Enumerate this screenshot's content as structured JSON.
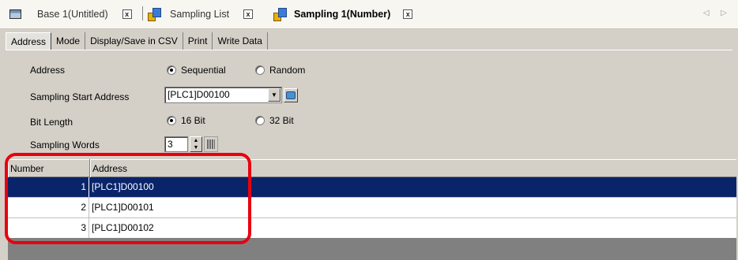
{
  "doc_tabs": [
    {
      "label": "Base 1(Untitled)",
      "icon": "screen-icon"
    },
    {
      "label": "Sampling List",
      "icon": "sampling-icon"
    },
    {
      "label": "Sampling 1(Number)",
      "icon": "sampling-icon",
      "active": true
    }
  ],
  "close_glyph": "x",
  "scroll_glyphs": "◁ ▷",
  "sub_tabs": [
    {
      "label": "Address",
      "active": true
    },
    {
      "label": "Mode"
    },
    {
      "label": "Display/Save in CSV"
    },
    {
      "label": "Print"
    },
    {
      "label": "Write Data"
    }
  ],
  "form": {
    "address_label": "Address",
    "address_options": [
      {
        "label": "Sequential",
        "selected": true
      },
      {
        "label": "Random",
        "selected": false
      }
    ],
    "start_address_label": "Sampling Start Address",
    "start_address_value": "[PLC1]D00100",
    "bit_length_label": "Bit Length",
    "bit_length_options": [
      {
        "label": "16 Bit",
        "selected": true
      },
      {
        "label": "32 Bit",
        "selected": false
      }
    ],
    "sampling_words_label": "Sampling Words",
    "sampling_words_value": "3"
  },
  "grid": {
    "columns": [
      "Number",
      "Address"
    ],
    "rows": [
      {
        "number": "1",
        "address": "[PLC1]D00100",
        "selected": true
      },
      {
        "number": "2",
        "address": "[PLC1]D00101",
        "selected": false
      },
      {
        "number": "3",
        "address": "[PLC1]D00102",
        "selected": false
      }
    ]
  },
  "colors": {
    "highlight": "#e8000f",
    "selection": "#0a246a"
  }
}
